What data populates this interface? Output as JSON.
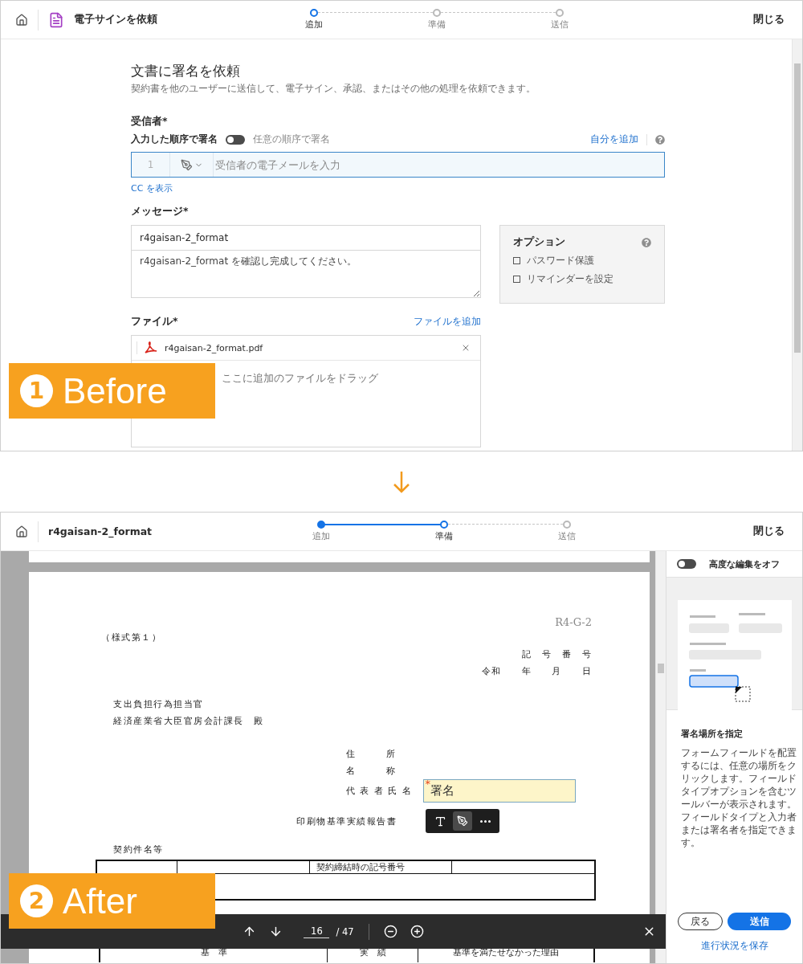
{
  "before": {
    "badge": {
      "number": "1",
      "label": "Before"
    },
    "header": {
      "title": "電子サインを依頼",
      "close": "閉じる",
      "steps": [
        {
          "label": "追加",
          "completed": false,
          "selected": true
        },
        {
          "label": "準備",
          "completed": false,
          "selected": false
        },
        {
          "label": "送信",
          "completed": false,
          "selected": false
        }
      ]
    },
    "form": {
      "title": "文書に署名を依頼",
      "subtitle": "契約書を他のユーザーに送信して、電子サイン、承認、またはその他の処理を依頼できます。",
      "recipients": {
        "label": "受信者*",
        "order_label": "入力した順序で署名",
        "order_toggle": {
          "on": false
        },
        "any_order_label": "任意の順序で署名",
        "add_self": "自分を追加",
        "rows": [
          {
            "number": "1",
            "placeholder": "受信者の電子メールを入力"
          }
        ],
        "cc_link": "CC を表示"
      },
      "message": {
        "label": "メッセージ*",
        "subject": "r4gaisan-2_format",
        "body": "r4gaisan-2_format を確認し完成してください。"
      },
      "options": {
        "title": "オプション",
        "items": [
          {
            "label": "パスワード保護",
            "checked": false
          },
          {
            "label": "リマインダーを設定",
            "checked": false
          }
        ]
      },
      "files": {
        "label": "ファイル*",
        "add_link": "ファイルを追加",
        "items": [
          {
            "name": "r4gaisan-2_format.pdf"
          }
        ],
        "drop_hint": "ここに追加のファイルをドラッグ"
      }
    }
  },
  "after": {
    "badge": {
      "number": "2",
      "label": "After"
    },
    "header": {
      "title": "r4gaisan-2_format",
      "close": "閉じる",
      "steps": [
        {
          "label": "追加",
          "completed": true,
          "selected": false
        },
        {
          "label": "準備",
          "completed": false,
          "selected": true
        },
        {
          "label": "送信",
          "completed": false,
          "selected": false
        }
      ]
    },
    "document": {
      "code": "R4-G-2",
      "form_no": "（様式第１）",
      "ref_lines": [
        "記　号　番　号",
        "令和　　年　　月　　日"
      ],
      "addressee_lines": [
        "支出負担行為担当官",
        "経済産業省大臣官房会計課長　殿"
      ],
      "sender_labels": [
        "住　　　所",
        "名　　　称",
        "代 表 者 氏 名"
      ],
      "signature_field": {
        "required_mark": "*",
        "label": "署名"
      },
      "report_title": "印刷物基準実績報告書",
      "field_tools": [
        {
          "kind": "text",
          "selected": false
        },
        {
          "kind": "signature",
          "selected": true
        },
        {
          "kind": "more",
          "selected": false
        }
      ],
      "contract_heading": "契約件名等",
      "contract_table": {
        "column_3": "契約締結時の記号番号"
      },
      "criteria_table": {
        "columns": [
          "基　準",
          "実　績",
          "基準を満たせなかった理由"
        ]
      }
    },
    "page_nav": {
      "current_page": "16",
      "total": "/ 47"
    },
    "sidebar": {
      "toggle_label": "高度な編集をオフ",
      "toggle": {
        "on": false
      },
      "heading": "署名場所を指定",
      "text": "フォームフィールドを配置するには、任意の場所をクリックします。フィールドタイプオプションを含むツールバーが表示されます。フィールドタイプと入力者または署名者を指定できます。",
      "back": "戻る",
      "send": "送信",
      "save_link": "進行状況を保存"
    }
  }
}
